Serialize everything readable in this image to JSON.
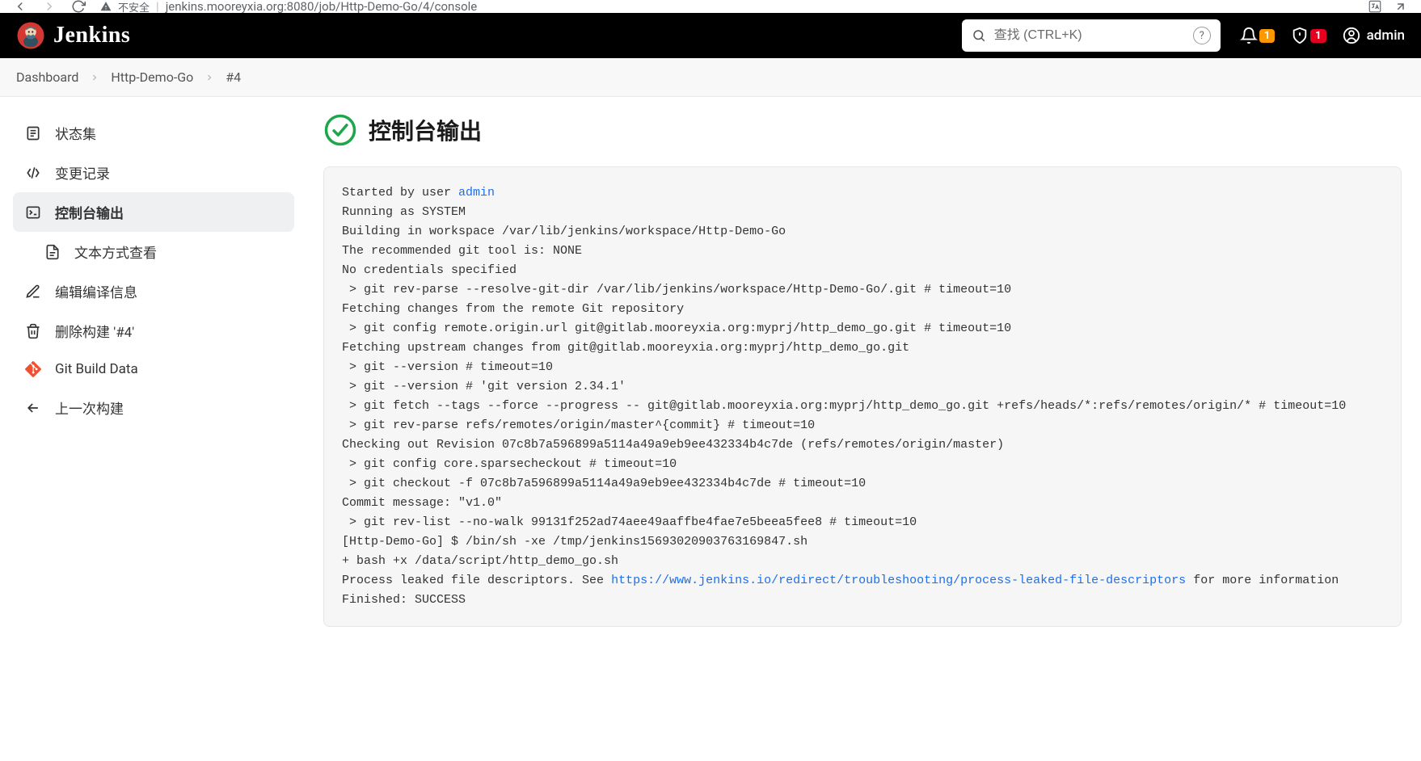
{
  "browser": {
    "url_insecure_label": "不安全",
    "url": "jenkins.mooreyxia.org:8080/job/Http-Demo-Go/4/console"
  },
  "header": {
    "brand": "Jenkins",
    "search_placeholder": "查找 (CTRL+K)",
    "help_char": "?",
    "bell_badge": "1",
    "shield_badge": "1",
    "username": "admin"
  },
  "breadcrumbs": {
    "items": [
      "Dashboard",
      "Http-Demo-Go",
      "#4"
    ]
  },
  "sidebar": {
    "items": {
      "status": "状态集",
      "changes": "变更记录",
      "console": "控制台输出",
      "plain_text": "文本方式查看",
      "edit_build": "编辑编译信息",
      "delete_build": "删除构建 '#4'",
      "git_build_data": "Git Build Data",
      "prev_build": "上一次构建"
    }
  },
  "page": {
    "title": "控制台输出"
  },
  "console": {
    "started_by_prefix": "Started by user ",
    "started_by_user_link": "admin",
    "lines_after_user": "\nRunning as SYSTEM\nBuilding in workspace /var/lib/jenkins/workspace/Http-Demo-Go\nThe recommended git tool is: NONE\nNo credentials specified\n > git rev-parse --resolve-git-dir /var/lib/jenkins/workspace/Http-Demo-Go/.git # timeout=10\nFetching changes from the remote Git repository\n > git config remote.origin.url git@gitlab.mooreyxia.org:myprj/http_demo_go.git # timeout=10\nFetching upstream changes from git@gitlab.mooreyxia.org:myprj/http_demo_go.git\n > git --version # timeout=10\n > git --version # 'git version 2.34.1'\n > git fetch --tags --force --progress -- git@gitlab.mooreyxia.org:myprj/http_demo_go.git +refs/heads/*:refs/remotes/origin/* # timeout=10\n > git rev-parse refs/remotes/origin/master^{commit} # timeout=10\nChecking out Revision 07c8b7a596899a5114a49a9eb9ee432334b4c7de (refs/remotes/origin/master)\n > git config core.sparsecheckout # timeout=10\n > git checkout -f 07c8b7a596899a5114a49a9eb9ee432334b4c7de # timeout=10\nCommit message: \"v1.0\"\n > git rev-list --no-walk 99131f252ad74aee49aaffbe4fae7e5beea5fee8 # timeout=10\n[Http-Demo-Go] $ /bin/sh -xe /tmp/jenkins15693020903763169847.sh\n+ bash +x /data/script/http_demo_go.sh\nProcess leaked file descriptors. See ",
    "leak_link_text": "https://www.jenkins.io/redirect/troubleshooting/process-leaked-file-descriptors",
    "tail": " for more information\nFinished: SUCCESS"
  }
}
